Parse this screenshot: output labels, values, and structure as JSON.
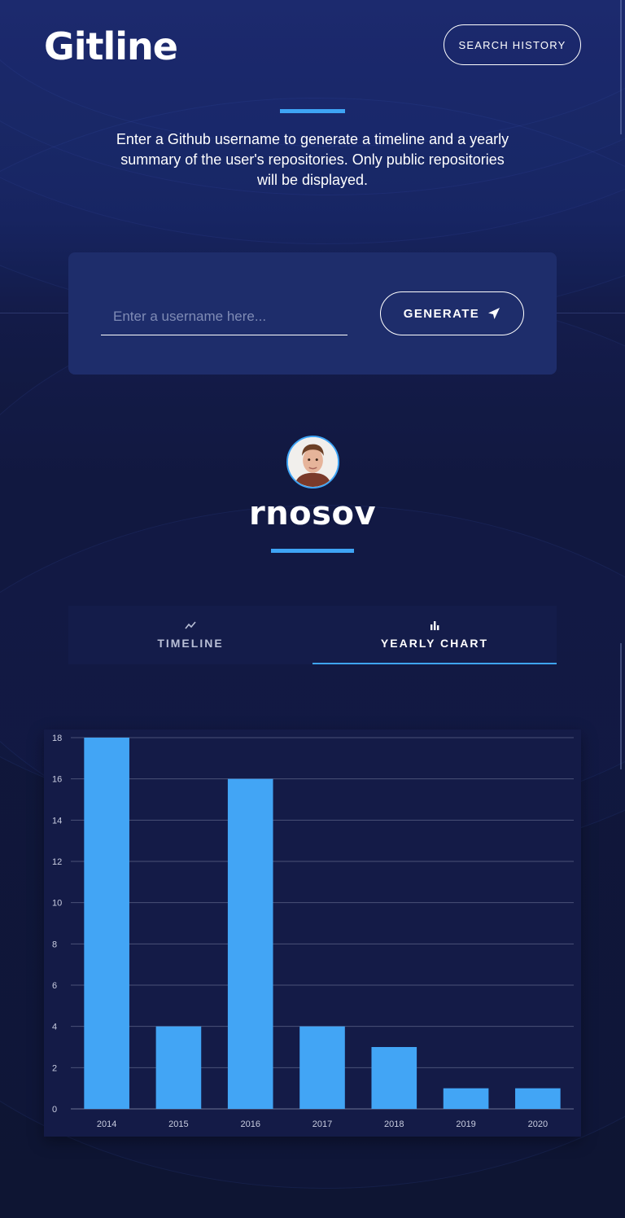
{
  "header": {
    "logo": "Gitline",
    "history_button": "SEARCH HISTORY"
  },
  "intro": {
    "text": "Enter a Github username to generate a timeline and a yearly summary of the user's repositories. Only public repositories will be displayed."
  },
  "search": {
    "placeholder": "Enter a username here...",
    "value": "",
    "generate_button": "GENERATE",
    "generate_icon": "paper-plane-icon"
  },
  "profile": {
    "username": "rnosov",
    "avatar": "user-avatar"
  },
  "tabs": [
    {
      "label": "TIMELINE",
      "icon": "line-chart-icon",
      "active": false
    },
    {
      "label": "YEARLY CHART",
      "icon": "bar-chart-icon",
      "active": true
    }
  ],
  "colors": {
    "accent": "#3ea4f5",
    "background": "#0f1636",
    "card": "#1e2d6b",
    "bar": "#42a5f5"
  },
  "chart_data": {
    "type": "bar",
    "categories": [
      "2014",
      "2015",
      "2016",
      "2017",
      "2018",
      "2019",
      "2020"
    ],
    "values": [
      18,
      4,
      16,
      4,
      3,
      1,
      1
    ],
    "ylim": [
      0,
      18
    ],
    "yticks": [
      0,
      2,
      4,
      6,
      8,
      10,
      12,
      14,
      16,
      18
    ],
    "title": "",
    "xlabel": "",
    "ylabel": "",
    "grid": true,
    "legend": "none"
  }
}
